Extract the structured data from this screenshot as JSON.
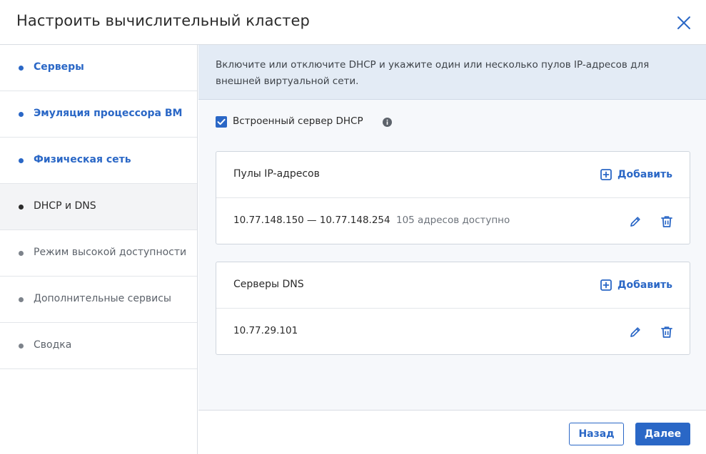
{
  "dialog": {
    "title": "Настроить вычислительный кластер"
  },
  "colors": {
    "accent": "#2a67c6",
    "banner_bg": "#e3ebf5",
    "content_bg": "#f6f8fb"
  },
  "steps": [
    {
      "label": "Серверы",
      "state": "done"
    },
    {
      "label": "Эмуляция процессора ВМ",
      "state": "done"
    },
    {
      "label": "Физическая сеть",
      "state": "done"
    },
    {
      "label": "DHCP и DNS",
      "state": "active"
    },
    {
      "label": "Режим высокой доступности",
      "state": "todo"
    },
    {
      "label": "Дополнительные сервисы",
      "state": "todo"
    },
    {
      "label": "Сводка",
      "state": "todo"
    }
  ],
  "info": {
    "text": "Включите или отключите DHCP и укажите один или несколько пулов IP-адресов для внешней виртуальной сети."
  },
  "dhcp": {
    "label": "Встроенный сервер DHCP",
    "checked": true
  },
  "ip_pools": {
    "title": "Пулы IP-адресов",
    "add_label": "Добавить",
    "items": [
      {
        "range": "10.77.148.150 — 10.77.148.254",
        "note": "105 адресов доступно"
      }
    ]
  },
  "dns": {
    "title": "Серверы DNS",
    "add_label": "Добавить",
    "items": [
      {
        "address": "10.77.29.101"
      }
    ]
  },
  "footer": {
    "back_label": "Назад",
    "next_label": "Далее"
  }
}
